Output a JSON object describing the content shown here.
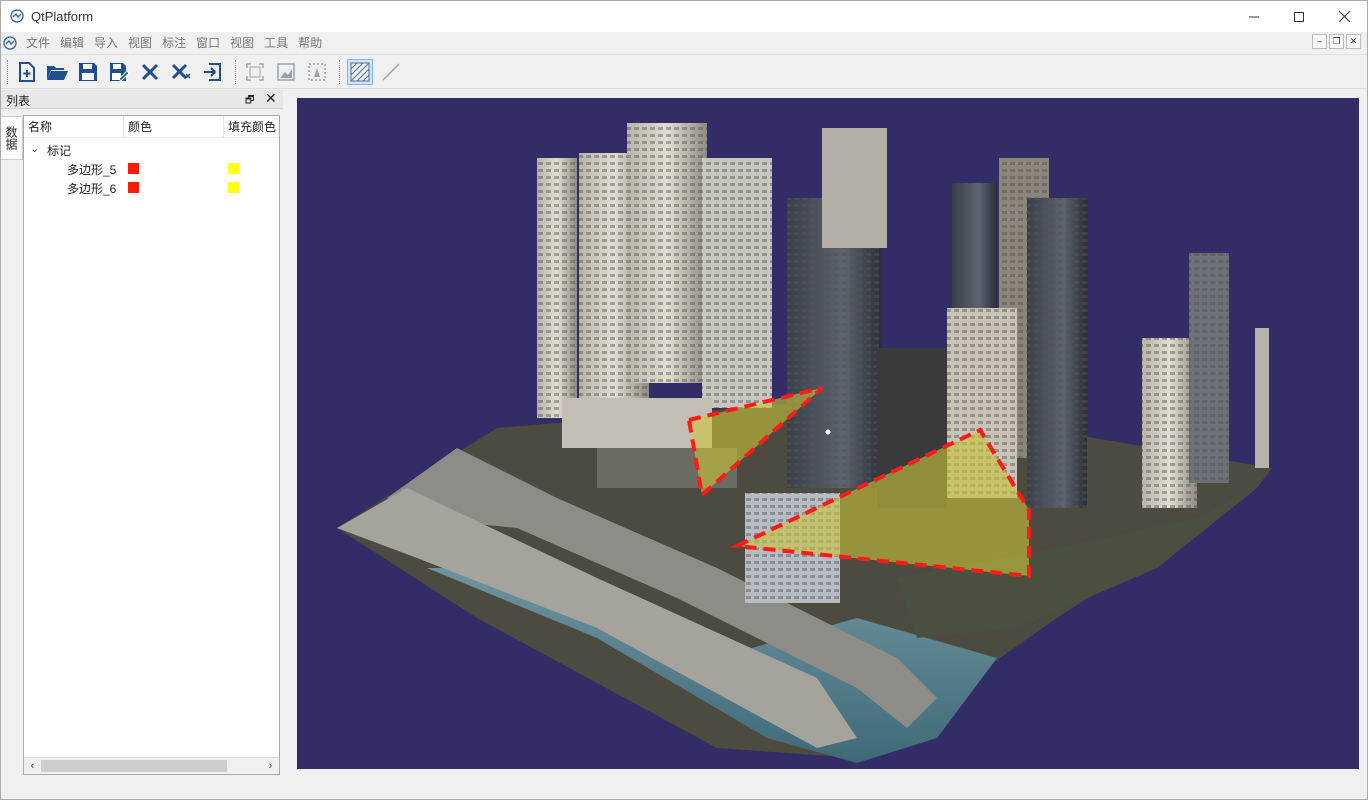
{
  "window": {
    "title": "QtPlatform"
  },
  "menu": {
    "items": [
      "文件",
      "编辑",
      "导入",
      "视图",
      "标注",
      "窗口",
      "视图",
      "工具",
      "帮助"
    ]
  },
  "toolbar": {
    "buttons": [
      {
        "icon": "new-file-icon"
      },
      {
        "icon": "open-folder-icon"
      },
      {
        "icon": "save-icon"
      },
      {
        "icon": "save-as-icon"
      },
      {
        "icon": "close-x-icon"
      },
      {
        "icon": "close-all-icon"
      },
      {
        "icon": "exit-icon"
      },
      {
        "icon": "fit-view-icon"
      },
      {
        "icon": "image-view-icon"
      },
      {
        "icon": "screenshot-icon"
      },
      {
        "icon": "polygon-fill-icon",
        "active": true
      },
      {
        "icon": "line-draw-icon"
      }
    ]
  },
  "dock": {
    "title": "列表",
    "side_tab": "数据",
    "columns": [
      "名称",
      "颜色",
      "填充颜色"
    ],
    "root": "标记",
    "rows": [
      {
        "name": "多边形_5",
        "color": "#ff1a00",
        "fill": "#ffff1a"
      },
      {
        "name": "多边形_6",
        "color": "#ff1a00",
        "fill": "#ffff1a"
      }
    ]
  },
  "colors": {
    "viewport_bg": "#322d66",
    "outline": "#ff1a1a",
    "polygon_fill": "#c9c43a"
  }
}
